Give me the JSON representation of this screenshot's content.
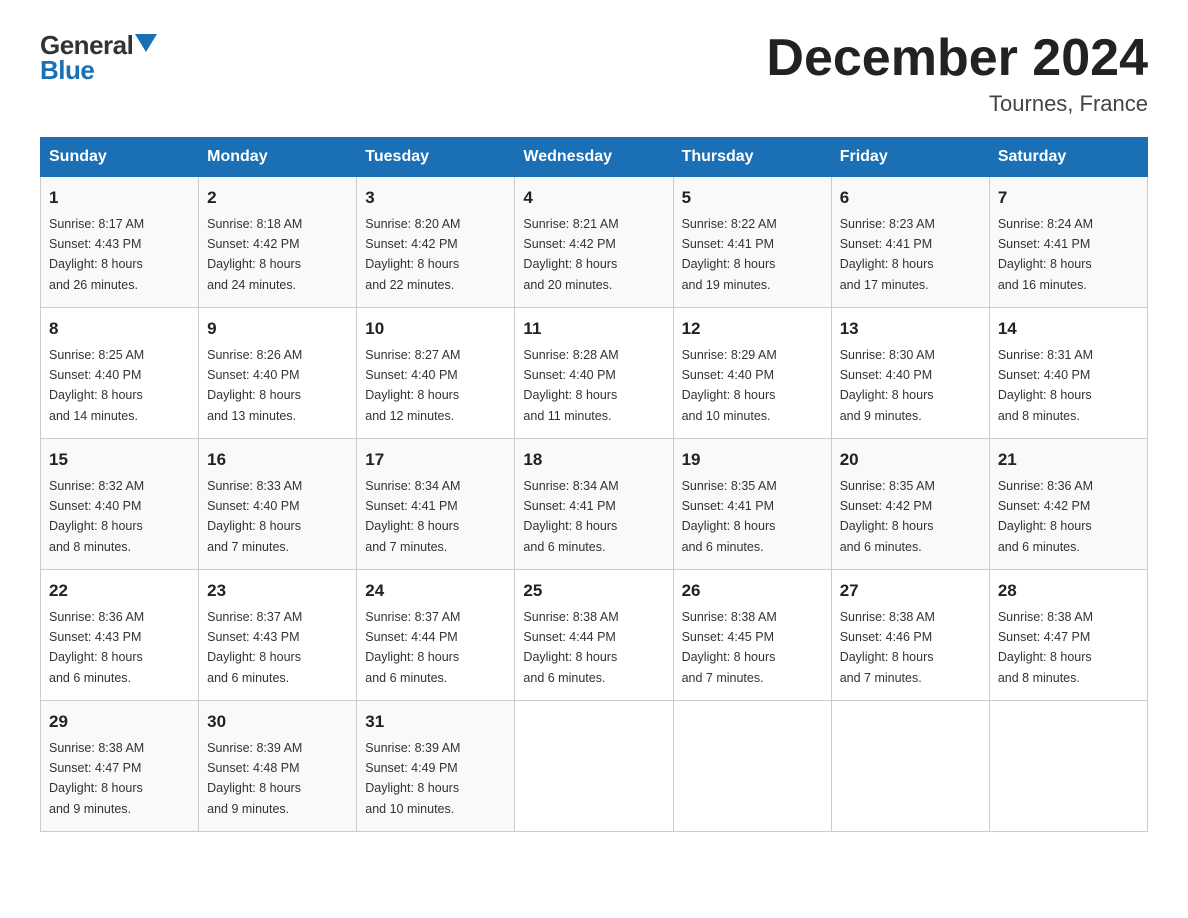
{
  "header": {
    "logo_general": "General",
    "logo_blue": "Blue",
    "month_year": "December 2024",
    "location": "Tournes, France"
  },
  "days_of_week": [
    "Sunday",
    "Monday",
    "Tuesday",
    "Wednesday",
    "Thursday",
    "Friday",
    "Saturday"
  ],
  "weeks": [
    [
      {
        "day": "1",
        "sunrise": "8:17 AM",
        "sunset": "4:43 PM",
        "daylight": "8 hours and 26 minutes."
      },
      {
        "day": "2",
        "sunrise": "8:18 AM",
        "sunset": "4:42 PM",
        "daylight": "8 hours and 24 minutes."
      },
      {
        "day": "3",
        "sunrise": "8:20 AM",
        "sunset": "4:42 PM",
        "daylight": "8 hours and 22 minutes."
      },
      {
        "day": "4",
        "sunrise": "8:21 AM",
        "sunset": "4:42 PM",
        "daylight": "8 hours and 20 minutes."
      },
      {
        "day": "5",
        "sunrise": "8:22 AM",
        "sunset": "4:41 PM",
        "daylight": "8 hours and 19 minutes."
      },
      {
        "day": "6",
        "sunrise": "8:23 AM",
        "sunset": "4:41 PM",
        "daylight": "8 hours and 17 minutes."
      },
      {
        "day": "7",
        "sunrise": "8:24 AM",
        "sunset": "4:41 PM",
        "daylight": "8 hours and 16 minutes."
      }
    ],
    [
      {
        "day": "8",
        "sunrise": "8:25 AM",
        "sunset": "4:40 PM",
        "daylight": "8 hours and 14 minutes."
      },
      {
        "day": "9",
        "sunrise": "8:26 AM",
        "sunset": "4:40 PM",
        "daylight": "8 hours and 13 minutes."
      },
      {
        "day": "10",
        "sunrise": "8:27 AM",
        "sunset": "4:40 PM",
        "daylight": "8 hours and 12 minutes."
      },
      {
        "day": "11",
        "sunrise": "8:28 AM",
        "sunset": "4:40 PM",
        "daylight": "8 hours and 11 minutes."
      },
      {
        "day": "12",
        "sunrise": "8:29 AM",
        "sunset": "4:40 PM",
        "daylight": "8 hours and 10 minutes."
      },
      {
        "day": "13",
        "sunrise": "8:30 AM",
        "sunset": "4:40 PM",
        "daylight": "8 hours and 9 minutes."
      },
      {
        "day": "14",
        "sunrise": "8:31 AM",
        "sunset": "4:40 PM",
        "daylight": "8 hours and 8 minutes."
      }
    ],
    [
      {
        "day": "15",
        "sunrise": "8:32 AM",
        "sunset": "4:40 PM",
        "daylight": "8 hours and 8 minutes."
      },
      {
        "day": "16",
        "sunrise": "8:33 AM",
        "sunset": "4:40 PM",
        "daylight": "8 hours and 7 minutes."
      },
      {
        "day": "17",
        "sunrise": "8:34 AM",
        "sunset": "4:41 PM",
        "daylight": "8 hours and 7 minutes."
      },
      {
        "day": "18",
        "sunrise": "8:34 AM",
        "sunset": "4:41 PM",
        "daylight": "8 hours and 6 minutes."
      },
      {
        "day": "19",
        "sunrise": "8:35 AM",
        "sunset": "4:41 PM",
        "daylight": "8 hours and 6 minutes."
      },
      {
        "day": "20",
        "sunrise": "8:35 AM",
        "sunset": "4:42 PM",
        "daylight": "8 hours and 6 minutes."
      },
      {
        "day": "21",
        "sunrise": "8:36 AM",
        "sunset": "4:42 PM",
        "daylight": "8 hours and 6 minutes."
      }
    ],
    [
      {
        "day": "22",
        "sunrise": "8:36 AM",
        "sunset": "4:43 PM",
        "daylight": "8 hours and 6 minutes."
      },
      {
        "day": "23",
        "sunrise": "8:37 AM",
        "sunset": "4:43 PM",
        "daylight": "8 hours and 6 minutes."
      },
      {
        "day": "24",
        "sunrise": "8:37 AM",
        "sunset": "4:44 PM",
        "daylight": "8 hours and 6 minutes."
      },
      {
        "day": "25",
        "sunrise": "8:38 AM",
        "sunset": "4:44 PM",
        "daylight": "8 hours and 6 minutes."
      },
      {
        "day": "26",
        "sunrise": "8:38 AM",
        "sunset": "4:45 PM",
        "daylight": "8 hours and 7 minutes."
      },
      {
        "day": "27",
        "sunrise": "8:38 AM",
        "sunset": "4:46 PM",
        "daylight": "8 hours and 7 minutes."
      },
      {
        "day": "28",
        "sunrise": "8:38 AM",
        "sunset": "4:47 PM",
        "daylight": "8 hours and 8 minutes."
      }
    ],
    [
      {
        "day": "29",
        "sunrise": "8:38 AM",
        "sunset": "4:47 PM",
        "daylight": "8 hours and 9 minutes."
      },
      {
        "day": "30",
        "sunrise": "8:39 AM",
        "sunset": "4:48 PM",
        "daylight": "8 hours and 9 minutes."
      },
      {
        "day": "31",
        "sunrise": "8:39 AM",
        "sunset": "4:49 PM",
        "daylight": "8 hours and 10 minutes."
      },
      null,
      null,
      null,
      null
    ]
  ],
  "labels": {
    "sunrise": "Sunrise:",
    "sunset": "Sunset:",
    "daylight": "Daylight:"
  }
}
